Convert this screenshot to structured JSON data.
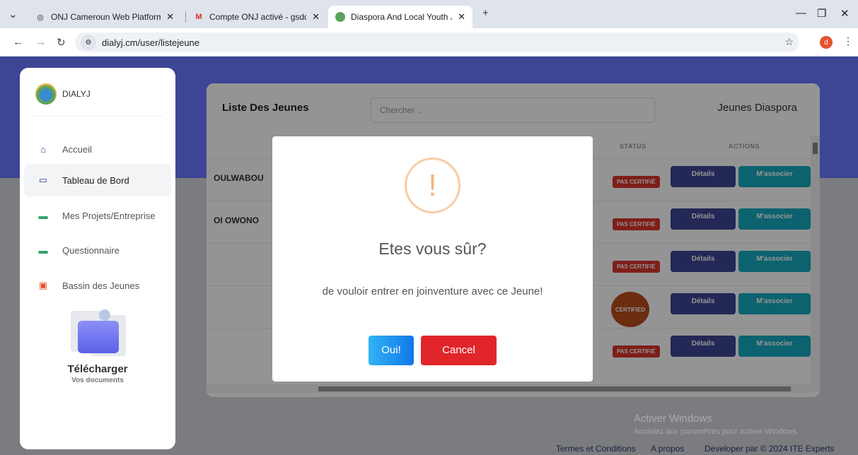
{
  "browser": {
    "tabs": [
      {
        "title": "ONJ Cameroun Web Platform",
        "icon": "globe-icon"
      },
      {
        "title": "Compte ONJ activé - gsddialyj@",
        "icon": "gmail-icon"
      },
      {
        "title": "Diaspora And Local Youth Joint",
        "icon": "site-icon"
      }
    ],
    "url": "dialyj.cm/user/listejeune",
    "profile_initial": "d"
  },
  "sidebar": {
    "brand": "DIALYJ",
    "items": [
      {
        "label": "Accueil",
        "icon": "home-icon"
      },
      {
        "label": "Tableau de Bord",
        "icon": "monitor-icon"
      },
      {
        "label": "Mes Projets/Entreprise",
        "icon": "card-icon"
      },
      {
        "label": "Questionnaire",
        "icon": "card-icon"
      },
      {
        "label": "Bassin des Jeunes",
        "icon": "calendar-icon"
      }
    ],
    "upload_title": "Télécharger",
    "upload_subtitle": "Vos documents"
  },
  "list": {
    "title": "Liste Des Jeunes",
    "search_placeholder": "Chercher ..",
    "filter": "Jeunes Diaspora",
    "col_status": "STATUS",
    "col_actions": "ACTIONS",
    "rows": [
      {
        "name": "OULWABOU",
        "status": "PAS CERTIFIÉ"
      },
      {
        "name": "OI OWONO",
        "status": "PAS CERTIFIÉ"
      },
      {
        "name": "",
        "status": "PAS CERTIFIÉ"
      },
      {
        "name": "",
        "status": "CERTIFIED"
      },
      {
        "name": "",
        "status": "PAS CERTIFIÉ"
      }
    ],
    "btn_details": "Détails",
    "btn_associate": "M'associer"
  },
  "modal": {
    "icon": "!",
    "title": "Etes vous sûr?",
    "text": "de vouloir entrer en joinventure avec ce Jeune!",
    "confirm": "Oui!",
    "cancel": "Cancel"
  },
  "footer": {
    "terms": "Termes et Conditions",
    "about": "A propos",
    "developer": "Developer par © 2024 ITE Experts"
  },
  "watermark": {
    "line1": "Activer Windows",
    "line2": "Accédez aux paramètres pour activer Windows."
  },
  "colors": {
    "primary": "#3d4595",
    "accent": "#18a9c0",
    "danger": "#e0262b"
  }
}
